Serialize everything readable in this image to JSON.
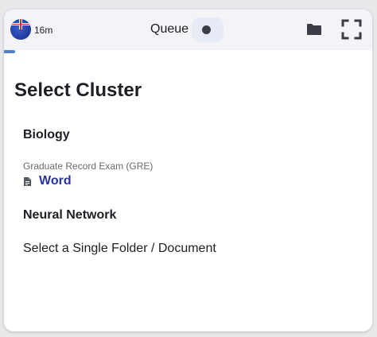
{
  "header": {
    "timer": "16m",
    "queue_label": "Queue",
    "progress": 0.03
  },
  "main": {
    "title": "Select Cluster",
    "clusters": [
      {
        "heading": "Biology",
        "items": [
          {
            "subtitle": "Graduate Record Exam (GRE)",
            "link_label": "Word"
          }
        ]
      },
      {
        "heading": "Neural Network",
        "items": [
          {
            "text": "Select a Single Folder / Document"
          }
        ]
      }
    ]
  },
  "colors": {
    "accent": "#4f82c8",
    "link": "#2833a8",
    "topbar": "#f4f4f8"
  },
  "icons": {
    "avatar": "flag-avatar-icon",
    "queue_toggle": "record-dot-icon",
    "folder": "folder-icon",
    "fullscreen": "fullscreen-icon",
    "document": "document-icon"
  }
}
